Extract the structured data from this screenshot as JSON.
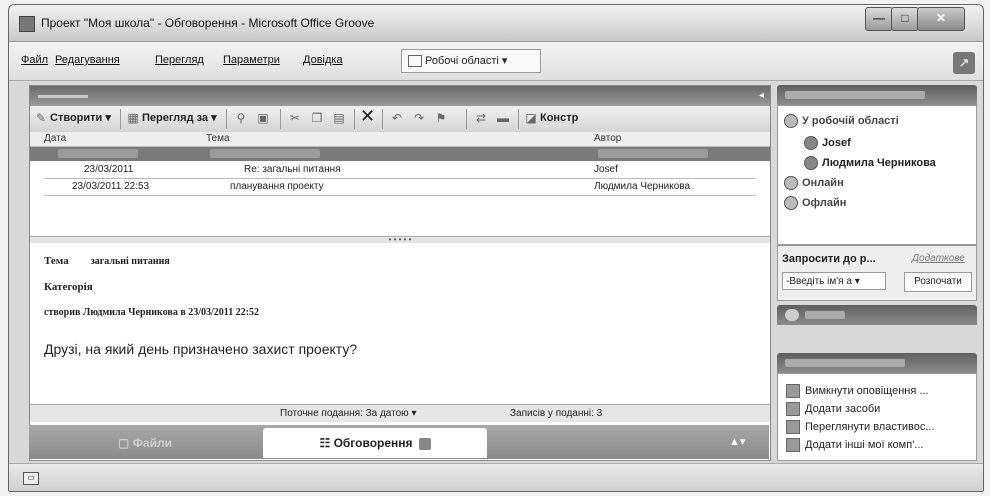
{
  "window": {
    "title": "Проект \"Моя школа\" - Обговорення - Microsoft Office Groove",
    "minimize": "—",
    "maximize": "□",
    "close": "✕"
  },
  "menu": {
    "items": [
      "Файл",
      "Редагування",
      "Перегляд",
      "Параметри",
      "Довідка"
    ],
    "workspaces_label": "Робочі області ▾"
  },
  "toolbar": {
    "create_label": "Створити ▾",
    "view_by_label": "Перегляд за ▾",
    "constr_label": "Констр"
  },
  "grid": {
    "columns": [
      "Дата",
      "Тема",
      "Автор"
    ],
    "rows": [
      {
        "date": "23/03/2011",
        "topic": "Re: загальні питання",
        "author": "Josef"
      },
      {
        "date": "23/03/2011 22:53",
        "topic": "планування проекту",
        "author": "Людмила Черникова"
      }
    ]
  },
  "preview": {
    "topic_label": "Тема",
    "topic_value": "загальні питання",
    "category_label": "Категорія",
    "created_text": "створив Людмила Черникова в 23/03/2011 22:52",
    "body": "Друзі, на який день призначено захист проекту?"
  },
  "status": {
    "current_view": "Поточне подання: За датою ▾",
    "records": "Записів у поданні: 3"
  },
  "tabs": {
    "files": "Файли",
    "discussions": "Обговорення"
  },
  "members": {
    "in_workspace": "У робочій області",
    "users": [
      "Josef",
      "Людмила Черникова"
    ],
    "online": "Онлайн",
    "offline": "Офлайн"
  },
  "invite": {
    "label": "Запросити до р...",
    "more": "Додаткове",
    "input_placeholder": "-Введіть ім'я а ▾",
    "button": "Розпочати"
  },
  "common_tasks": {
    "items": [
      "Вимкнути оповіщення ...",
      "Додати засоби",
      "Переглянути властивос...",
      "Додати інші мої комп'..."
    ]
  }
}
